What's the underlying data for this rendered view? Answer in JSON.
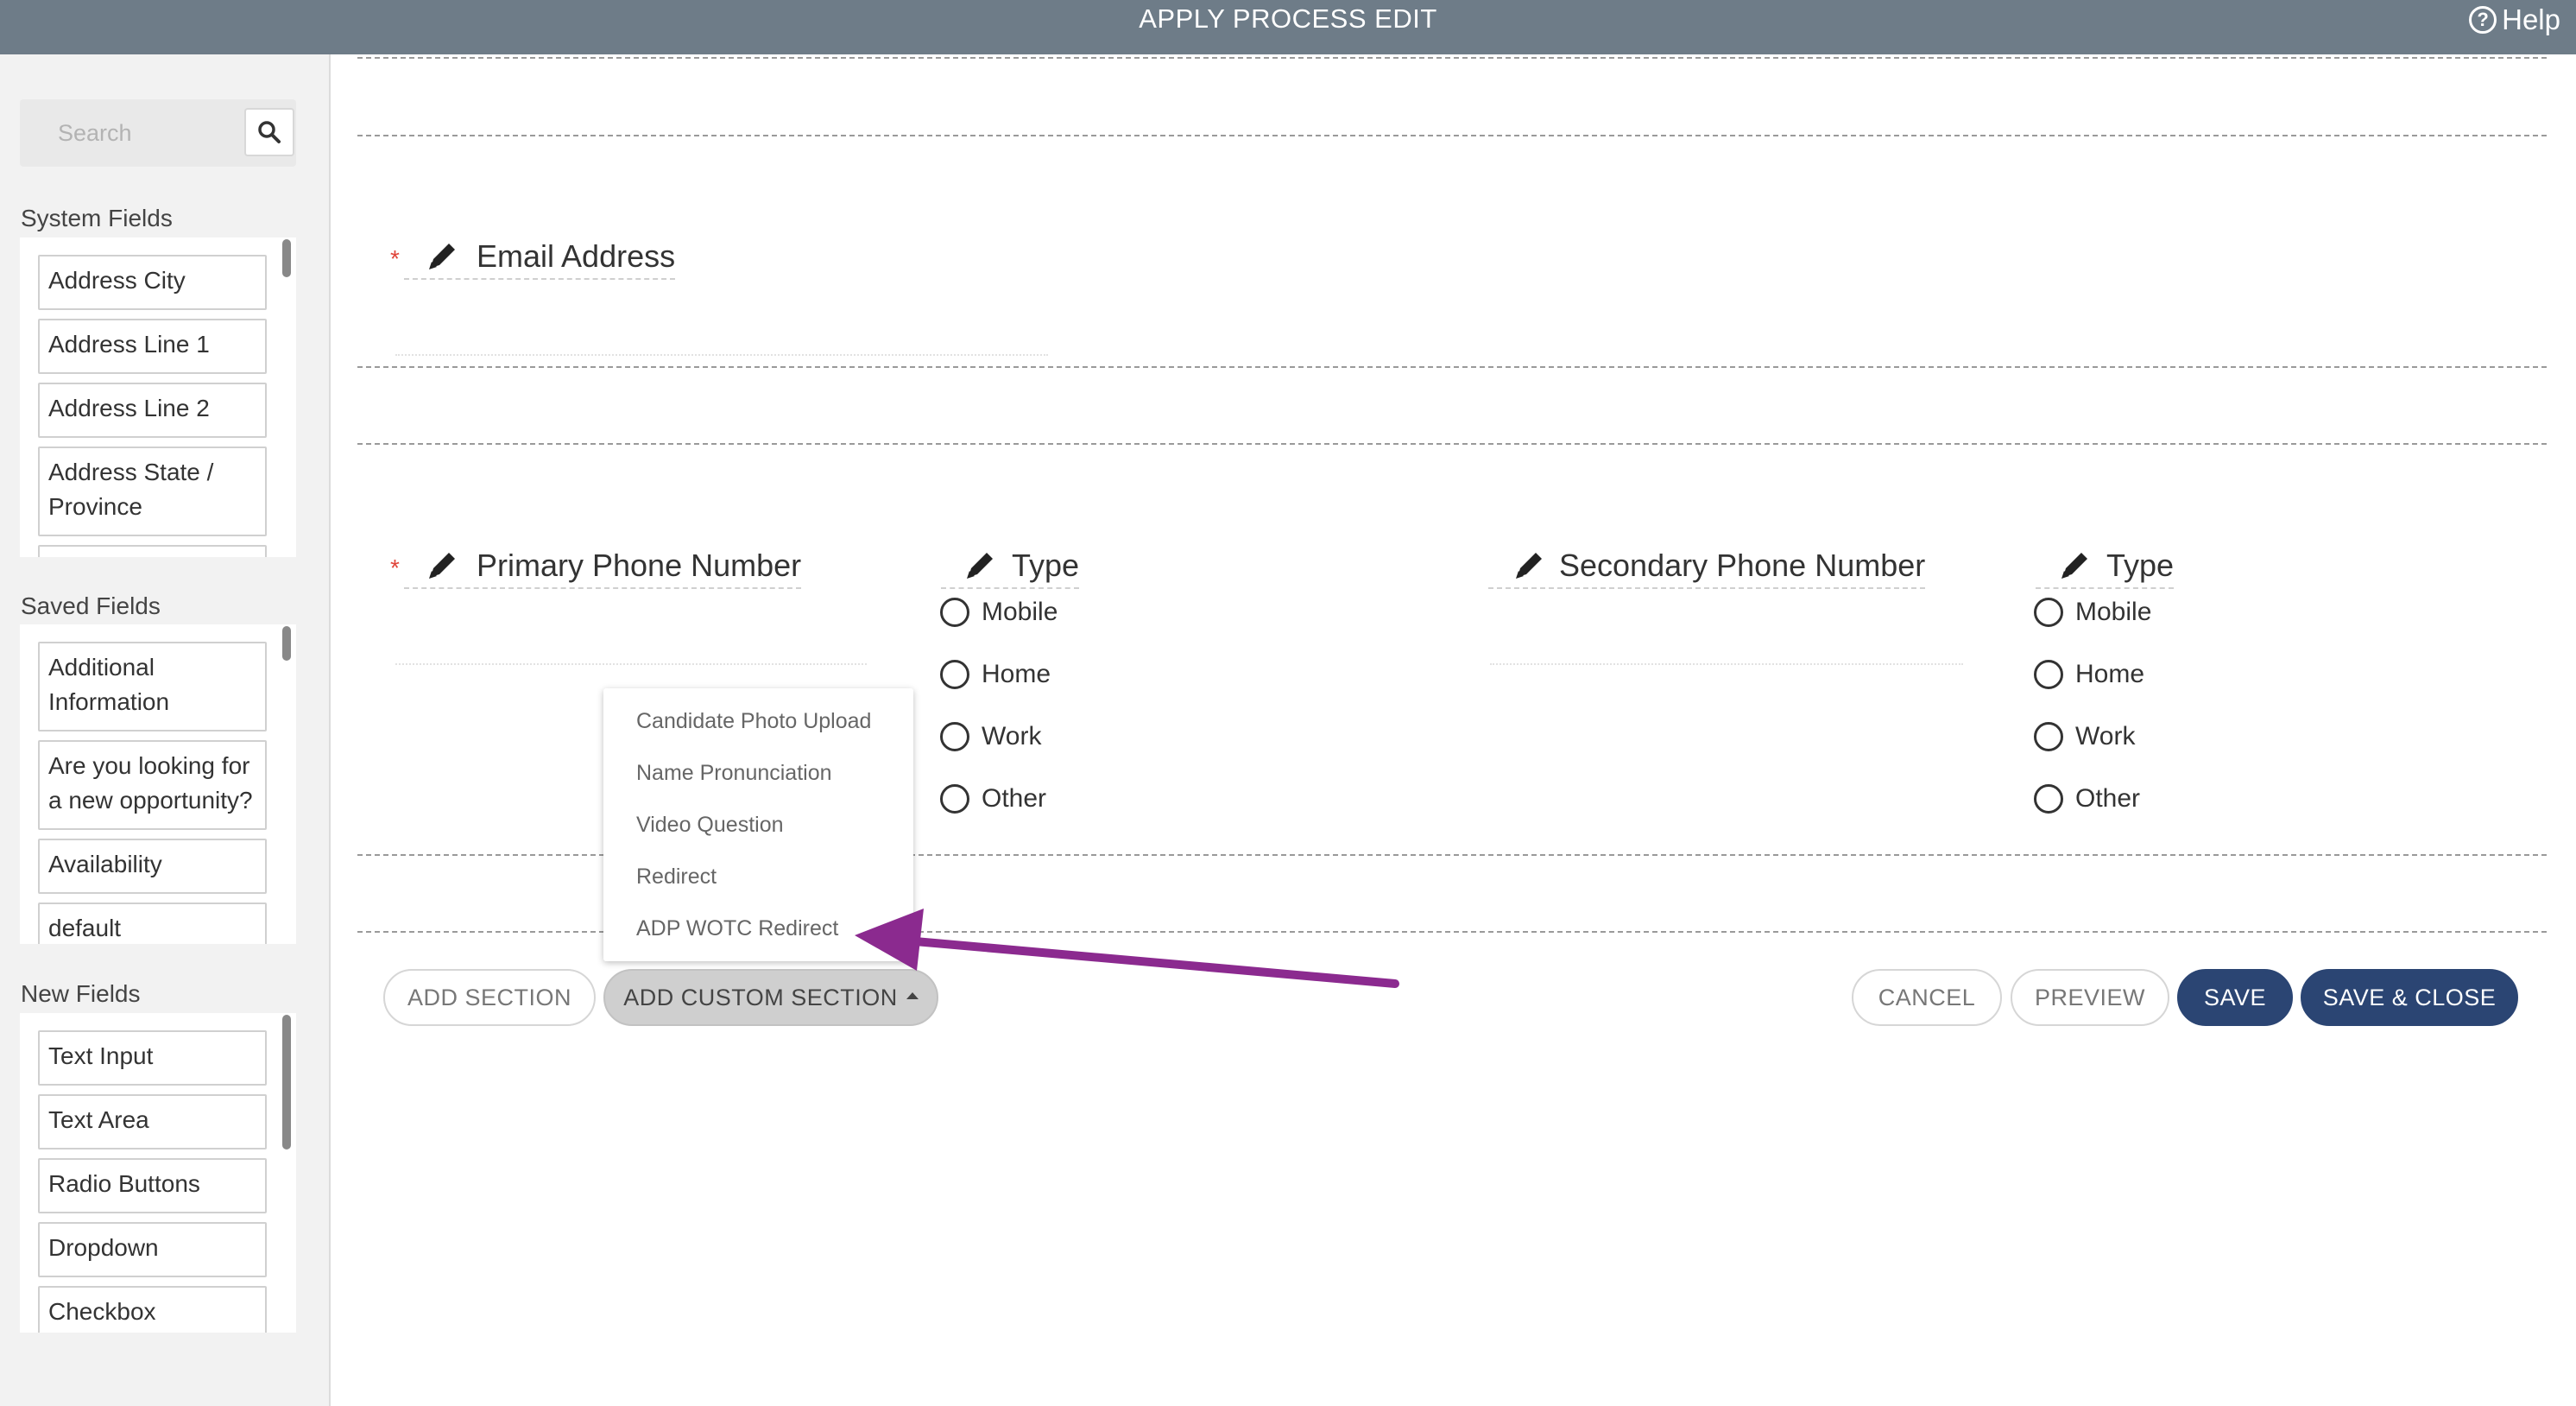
{
  "header": {
    "title": "APPLY PROCESS EDIT",
    "help_label": "Help"
  },
  "sidebar": {
    "search": {
      "placeholder": "Search"
    },
    "system_fields": {
      "title": "System Fields",
      "items": [
        "Address City",
        "Address Line 1",
        "Address Line 2",
        "Address State / Province"
      ]
    },
    "saved_fields": {
      "title": "Saved Fields",
      "items": [
        "Additional Information",
        "Are you looking for a new opportunity?",
        "Availability",
        "default"
      ]
    },
    "new_fields": {
      "title": "New Fields",
      "items": [
        "Text Input",
        "Text Area",
        "Radio Buttons",
        "Dropdown",
        "Checkbox"
      ]
    }
  },
  "form": {
    "required_marker": "*",
    "email": {
      "label": "Email Address"
    },
    "primary_phone": {
      "label": "Primary Phone Number"
    },
    "primary_type": {
      "label": "Type",
      "options": [
        "Mobile",
        "Home",
        "Work",
        "Other"
      ]
    },
    "secondary_phone": {
      "label": "Secondary Phone Number"
    },
    "secondary_type": {
      "label": "Type",
      "options": [
        "Mobile",
        "Home",
        "Work",
        "Other"
      ]
    }
  },
  "custom_section_menu": {
    "options": [
      "Candidate Photo Upload",
      "Name Pronunciation",
      "Video Question",
      "Redirect",
      "ADP WOTC Redirect"
    ]
  },
  "buttons": {
    "add_section": "ADD SECTION",
    "add_custom_section": "ADD CUSTOM SECTION",
    "cancel": "CANCEL",
    "preview": "PREVIEW",
    "save": "SAVE",
    "save_close": "SAVE & CLOSE"
  },
  "colors": {
    "header_bg": "#6e7c88",
    "primary_button": "#2b4573",
    "annotation_arrow": "#8b2a8f",
    "required": "#e0453a"
  },
  "icons": {
    "help": "help-circle-icon",
    "search": "search-icon",
    "edit": "pencil-icon",
    "caret": "caret-up-icon"
  }
}
